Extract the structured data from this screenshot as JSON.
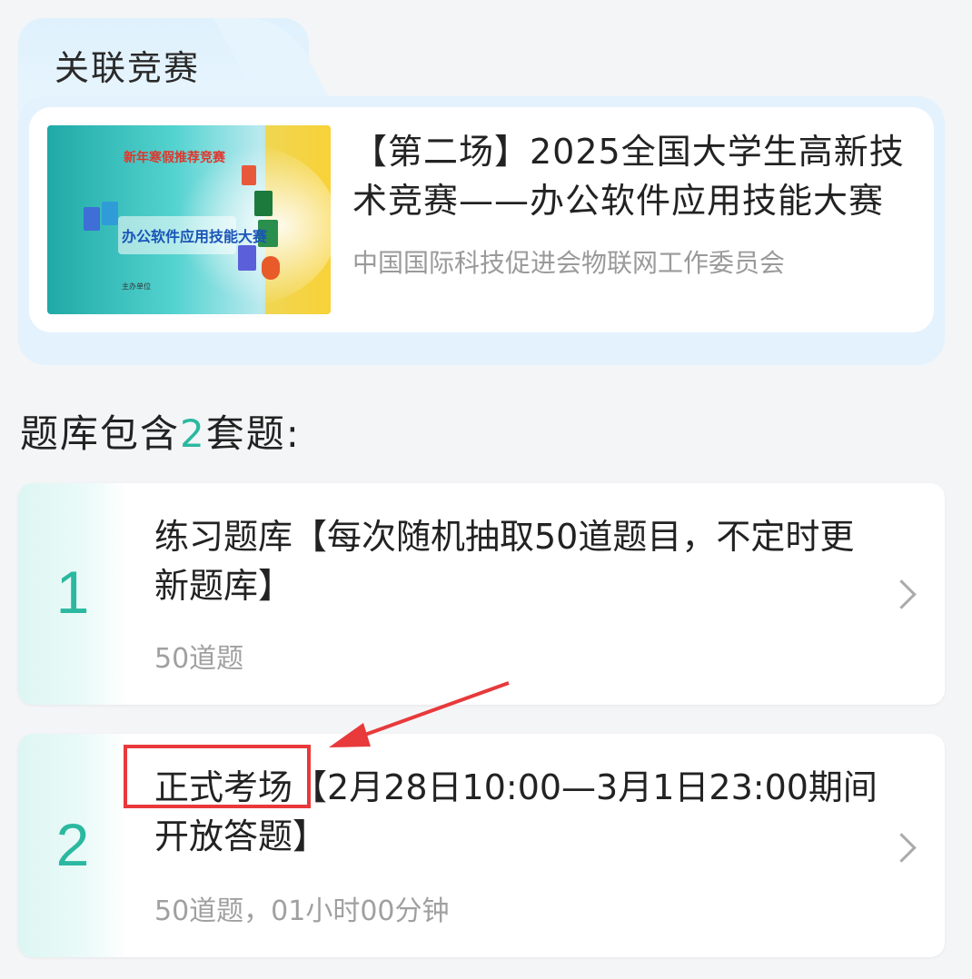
{
  "related": {
    "tab_title": "关联竞赛",
    "competition": {
      "title": "【第二场】2025全国大学生高新技术竞赛——办公软件应用技能大赛",
      "organizer": "中国国际科技促进会物联网工作委员会",
      "banner": {
        "headline": "新年寒假推荐竞赛",
        "main_text": "办公软件应用技能大赛",
        "footer": "主办单位"
      }
    }
  },
  "question_bank": {
    "heading_prefix": "题库包含",
    "count": "2",
    "heading_suffix": "套题:",
    "sets": [
      {
        "number": "1",
        "title": "练习题库【每次随机抽取50道题目，不定时更新题库】",
        "meta": "50道题"
      },
      {
        "number": "2",
        "highlight": "正式考场",
        "title_rest": "【2月28日10:00—3月1日23:00期间开放答题】",
        "meta": "50道题，01小时00分钟"
      }
    ]
  },
  "colors": {
    "accent": "#2bb8a0",
    "annotation": "#e8393b",
    "tab_bg": "#e3f2fd"
  },
  "icons": [
    "chevron-right-icon",
    "annotation-arrow-icon"
  ]
}
